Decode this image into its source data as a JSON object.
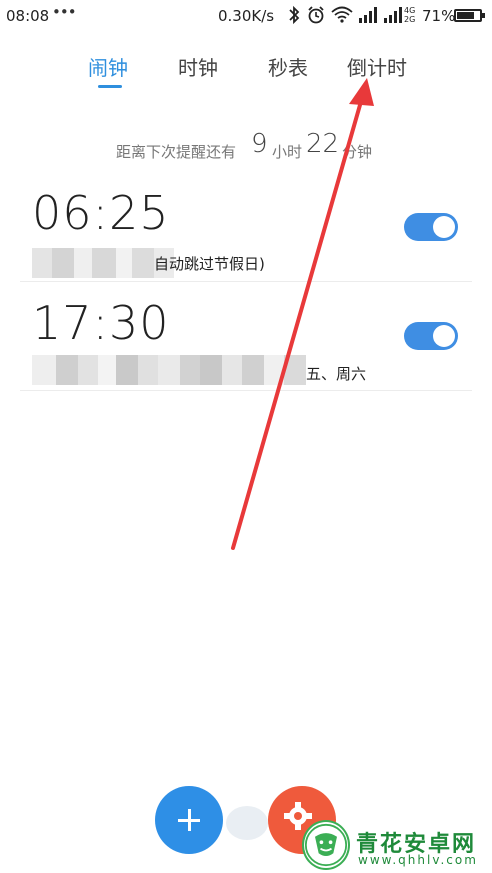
{
  "status_bar": {
    "time": "08:08",
    "dots": "•••",
    "speed": "0.30K/s",
    "network_top": "4G",
    "network_bottom": "2G",
    "battery_percent": "71%"
  },
  "tabs": [
    {
      "label": "闹钟",
      "active": true
    },
    {
      "label": "时钟",
      "active": false
    },
    {
      "label": "秒表",
      "active": false
    },
    {
      "label": "倒计时",
      "active": false
    }
  ],
  "next_alarm": {
    "prefix": "距离下次提醒还有",
    "hours": "9",
    "hours_unit": "小时",
    "minutes": "22",
    "minutes_unit": "分钟"
  },
  "alarms": [
    {
      "time": "06:25",
      "desc_visible": "自动跳过节假日)",
      "enabled": true
    },
    {
      "time": "17:30",
      "desc_visible": "五、周六",
      "enabled": true
    }
  ],
  "watermark": {
    "title": "青花安卓网",
    "url": "www.qhhlv.com"
  },
  "colors": {
    "accent": "#2f8fde",
    "toggle_on": "#3f8ee3",
    "fab_add": "#2e8fe6",
    "fab_settings": "#ef5a3c",
    "annotation": "#e8393a"
  }
}
